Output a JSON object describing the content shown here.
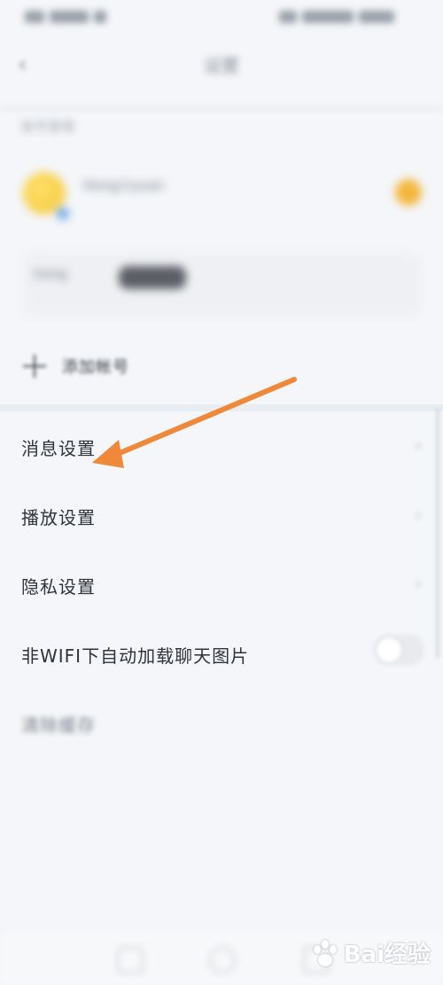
{
  "header": {
    "title": "设置"
  },
  "account_section": {
    "label": "账号管理",
    "primary": {
      "name": "Hong小yuan",
      "sub": ""
    },
    "secondary": {
      "name": "hong",
      "sub": "",
      "right": ""
    }
  },
  "add_account": {
    "label": "添加帐号"
  },
  "settings": {
    "message": {
      "label": "消息设置"
    },
    "playback": {
      "label": "播放设置"
    },
    "privacy": {
      "label": "隐私设置"
    },
    "wifi_autoload": {
      "label": "非WIFI下自动加载聊天图片",
      "enabled": false
    },
    "clear_cache": {
      "label": "清除缓存",
      "value": ""
    },
    "item6": {
      "label": "",
      "value": ""
    },
    "item7": {
      "label": "",
      "value": ""
    },
    "item8": {
      "label": ""
    }
  },
  "colors": {
    "annotation_arrow": "#f0883a",
    "background": "#f4f6f9"
  },
  "icons": {
    "back": "chevron-left-icon",
    "add": "plus-icon",
    "chevron": "chevron-right-icon"
  },
  "watermark": {
    "text": "Bai经验"
  }
}
